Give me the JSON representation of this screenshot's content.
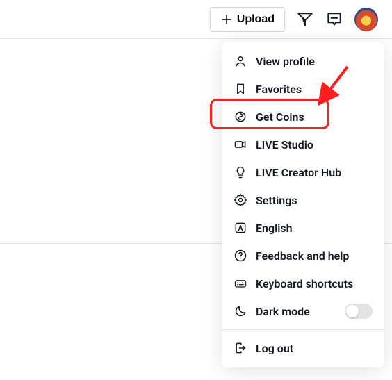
{
  "topbar": {
    "upload_label": "Upload"
  },
  "menu": {
    "items": [
      {
        "label": "View profile"
      },
      {
        "label": "Favorites"
      },
      {
        "label": "Get Coins"
      },
      {
        "label": "LIVE Studio"
      },
      {
        "label": "LIVE Creator Hub"
      },
      {
        "label": "Settings"
      },
      {
        "label": "English"
      },
      {
        "label": "Feedback and help"
      },
      {
        "label": "Keyboard shortcuts"
      },
      {
        "label": "Dark mode"
      }
    ],
    "logout_label": "Log out"
  },
  "annotations": {
    "highlighted_item_index": 2
  }
}
